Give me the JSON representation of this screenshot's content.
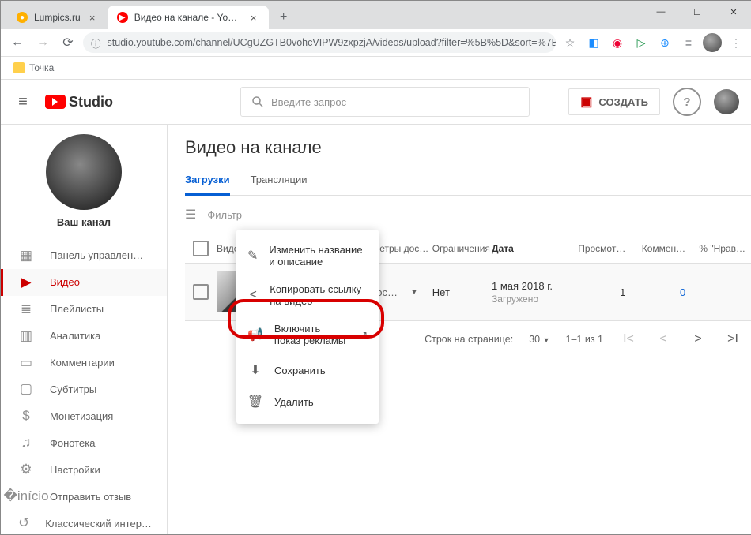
{
  "window": {
    "tab1_title": "Lumpics.ru",
    "tab2_title": "Видео на канале - YouTube Stu...",
    "url": "studio.youtube.com/channel/UCgUZGTB0vohcVIPW9zxpzjA/videos/upload?filter=%5B%5D&sort=%7B\"columnType\"%3A\"date\"%2C\"sortOrder\"%…",
    "bookmark": "Точка"
  },
  "header": {
    "logo_text": "Studio",
    "search_placeholder": "Введите запрос",
    "create_label": "СОЗДАТЬ"
  },
  "channel": {
    "name": "Ваш канал"
  },
  "sidebar": {
    "items": [
      {
        "label": "Панель управлен…"
      },
      {
        "label": "Видео"
      },
      {
        "label": "Плейлисты"
      },
      {
        "label": "Аналитика"
      },
      {
        "label": "Комментарии"
      },
      {
        "label": "Субтитры"
      },
      {
        "label": "Монетизация"
      },
      {
        "label": "Фонотека"
      }
    ],
    "bottom": [
      {
        "label": "Настройки"
      },
      {
        "label": "Отправить отзыв"
      },
      {
        "label": "Классический интер…"
      }
    ]
  },
  "main": {
    "title": "Видео на канале",
    "tabs": [
      {
        "label": "Загрузки"
      },
      {
        "label": "Трансляции"
      }
    ],
    "filter_label": "Фильтр",
    "columns": {
      "video": "Видео",
      "visibility": "Параметры дос…",
      "restrictions": "Ограничения",
      "date": "Дата",
      "views": "Просмот…",
      "comments": "Коммен…",
      "likes": "% \"Нрав…"
    },
    "rows": [
      {
        "visibility": "Дос…",
        "restrictions": "Нет",
        "date_primary": "1 мая 2018 г.",
        "date_secondary": "Загружено",
        "views": "1",
        "comments": "0"
      }
    ],
    "pager": {
      "rows_label": "Строк на странице:",
      "rows_value": "30",
      "range": "1–1 из 1"
    }
  },
  "menu": {
    "items": [
      {
        "label": "Изменить название и описание"
      },
      {
        "label": "Копировать ссылку на видео"
      },
      {
        "label": "Включить показ рекламы"
      },
      {
        "label": "Сохранить"
      },
      {
        "label": "Удалить"
      }
    ]
  }
}
